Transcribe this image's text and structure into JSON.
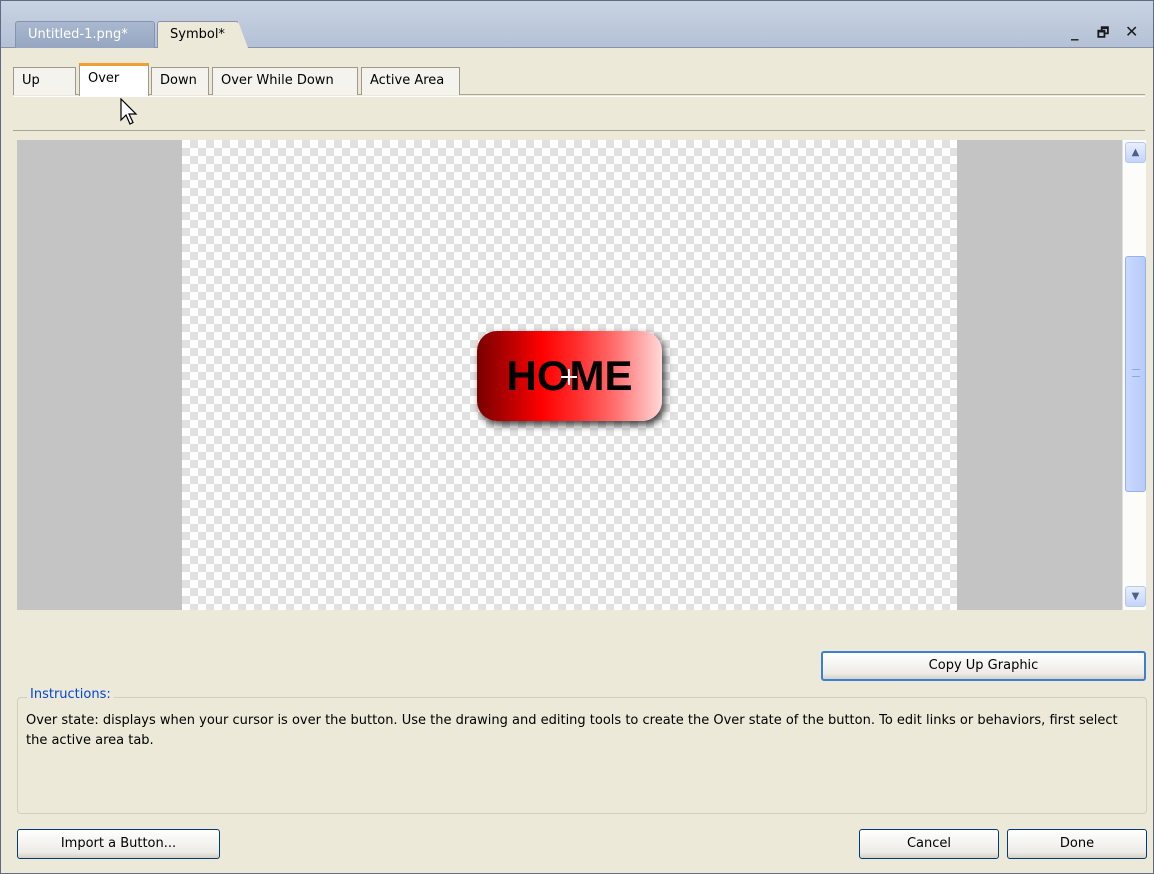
{
  "doc_tabs": [
    {
      "label": "Untitled-1.png*"
    },
    {
      "label": "Symbol*"
    }
  ],
  "window_controls": {
    "minimize": "_",
    "restore": "🗗",
    "close": "✕"
  },
  "state_tabs": [
    {
      "label": "Up"
    },
    {
      "label": "Over"
    },
    {
      "label": "Down"
    },
    {
      "label": "Over While Down"
    },
    {
      "label": "Active Area"
    }
  ],
  "active_state_tab": "Over",
  "canvas": {
    "button_text": "HOME",
    "button_gradient": [
      "#7a0000",
      "#ff0000",
      "#ffd8d8"
    ]
  },
  "scrollbar": {
    "up_glyph": "▲",
    "down_glyph": "▼"
  },
  "copy_button": "Copy Up Graphic",
  "instructions": {
    "title": "Instructions:",
    "text": "Over state: displays when your cursor is over the button. Use the drawing and editing tools to create the Over state of the button. To edit links or behaviors, first select the active area tab."
  },
  "footer": {
    "import_label": "Import a Button...",
    "cancel_label": "Cancel",
    "done_label": "Done"
  },
  "colors": {
    "accent": "#f0a030",
    "link_blue": "#0046d5",
    "scroll_blue": "#c3d3fd"
  }
}
